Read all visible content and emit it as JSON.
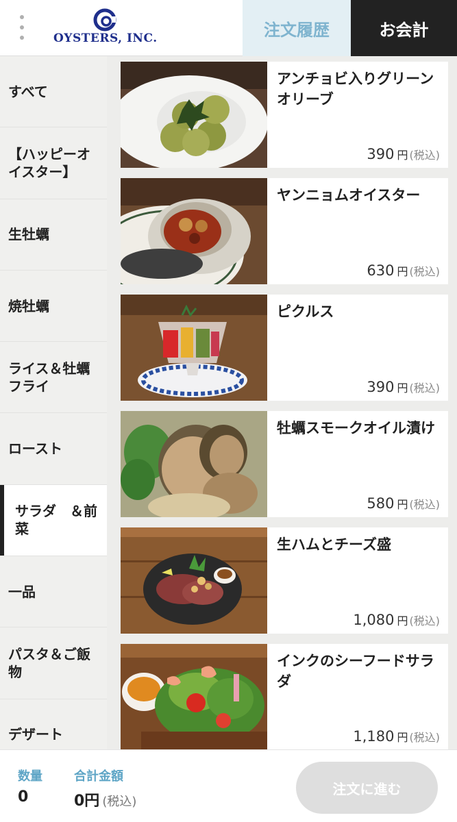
{
  "header": {
    "logo_text": "OYSTERS, INC.",
    "tab_history": "注文履歴",
    "tab_checkout": "お会計"
  },
  "sidebar": {
    "items": [
      {
        "label": "すべて"
      },
      {
        "label": "【ハッピーオイスター】"
      },
      {
        "label": "生牡蠣"
      },
      {
        "label": "焼牡蠣"
      },
      {
        "label": "ライス＆牡蠣フライ"
      },
      {
        "label": "ロースト"
      },
      {
        "label": "サラダ　＆前菜",
        "active": true
      },
      {
        "label": "一品"
      },
      {
        "label": "パスタ＆ご飯物"
      },
      {
        "label": "デザート"
      }
    ]
  },
  "menu": {
    "items": [
      {
        "name": "アンチョビ入りグリーンオリーブ",
        "price": "390",
        "image": "green-olives-photo"
      },
      {
        "name": "ヤンニョムオイスター",
        "price": "630",
        "image": "yangnyeom-oyster-photo"
      },
      {
        "name": "ピクルス",
        "price": "390",
        "image": "pickles-photo"
      },
      {
        "name": "牡蠣スモークオイル漬け",
        "price": "580",
        "image": "smoked-oyster-photo"
      },
      {
        "name": "生ハムとチーズ盛",
        "price": "1,080",
        "image": "ham-cheese-photo"
      },
      {
        "name": "インクのシーフードサラダ",
        "price": "1,180",
        "image": "seafood-salad-photo"
      }
    ],
    "currency": "円",
    "tax_note": "(税込)"
  },
  "footer": {
    "qty_label": "数量",
    "qty_value": "0",
    "total_label": "合計金額",
    "total_value": "0円",
    "total_tax": "(税込)",
    "order_button": "注文に進む"
  },
  "colors": {
    "accent_blue": "#5ea5c6",
    "history_tab_bg": "#e3eff4",
    "checkout_tab_bg": "#222222",
    "brand_navy": "#1f2f8c"
  }
}
